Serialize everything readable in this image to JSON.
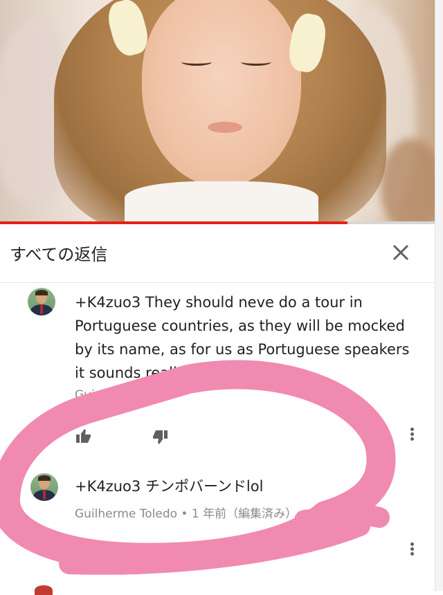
{
  "video": {
    "progress_fraction": 0.8
  },
  "header": {
    "title": "すべての返信",
    "close_icon": "close-icon"
  },
  "comments": [
    {
      "text_lines": [
        "+K4zuo3 They should neve do a tour in",
        "Portuguese countries, as they will be mocked",
        "by its name, as for us as Portuguese speakers",
        "it sounds really ridiculous!"
      ],
      "meta_partial": "Gui",
      "actions": [
        "thumbs-up-icon",
        "thumbs-down-icon",
        "more-vert-icon"
      ]
    },
    {
      "text": "+K4zuo3 チンポバーンドlol",
      "author": "Guilherme Toledo",
      "separator": "•",
      "time": "1 年前（編集済み）",
      "actions": [
        "more-vert-icon"
      ]
    }
  ],
  "colors": {
    "accent_red": "#e62117",
    "highlight_pink": "#f18ab0",
    "text": "#212121",
    "meta": "#8a8a8a"
  }
}
